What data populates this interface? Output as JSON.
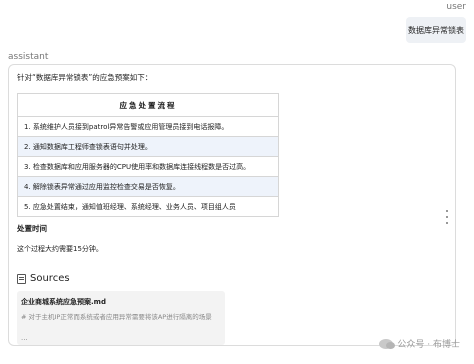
{
  "roles": {
    "user": "user",
    "assistant": "assistant"
  },
  "user_message": "数据库异常锁表",
  "assistant": {
    "intro": "针对“数据库异常锁表”的应急预案如下：",
    "table": {
      "header": "应急处置流程",
      "rows": [
        "1. 系统维护人员接到patrol异常告警或应用管理员接到电话报障。",
        "2. 通知数据库工程师查锁表语句并处理。",
        "3. 检查数据库和应用服务器的CPU使用率和数据库连接线程数是否过高。",
        "4. 解除锁表异常通过应用监控检查交易是否恢复。",
        "5. 应急处置结束，通知值班经理、系统经理、业务人员、项目组人员"
      ]
    },
    "time_title": "处置时间",
    "time_text": "这个过程大约需要15分钟。",
    "sources_heading": "Sources",
    "source": {
      "title": "企业商城系统应急预案.md",
      "snippet": "# 对于主机IP正常而系统或者应用异常需要将该AP进行隔离的场景",
      "ellipsis": "..."
    }
  },
  "watermark": "公众号 · 布博士",
  "icons": {
    "sources": "book-icon",
    "menu": "more-vertical-icon",
    "watermark": "wechat-icon"
  }
}
